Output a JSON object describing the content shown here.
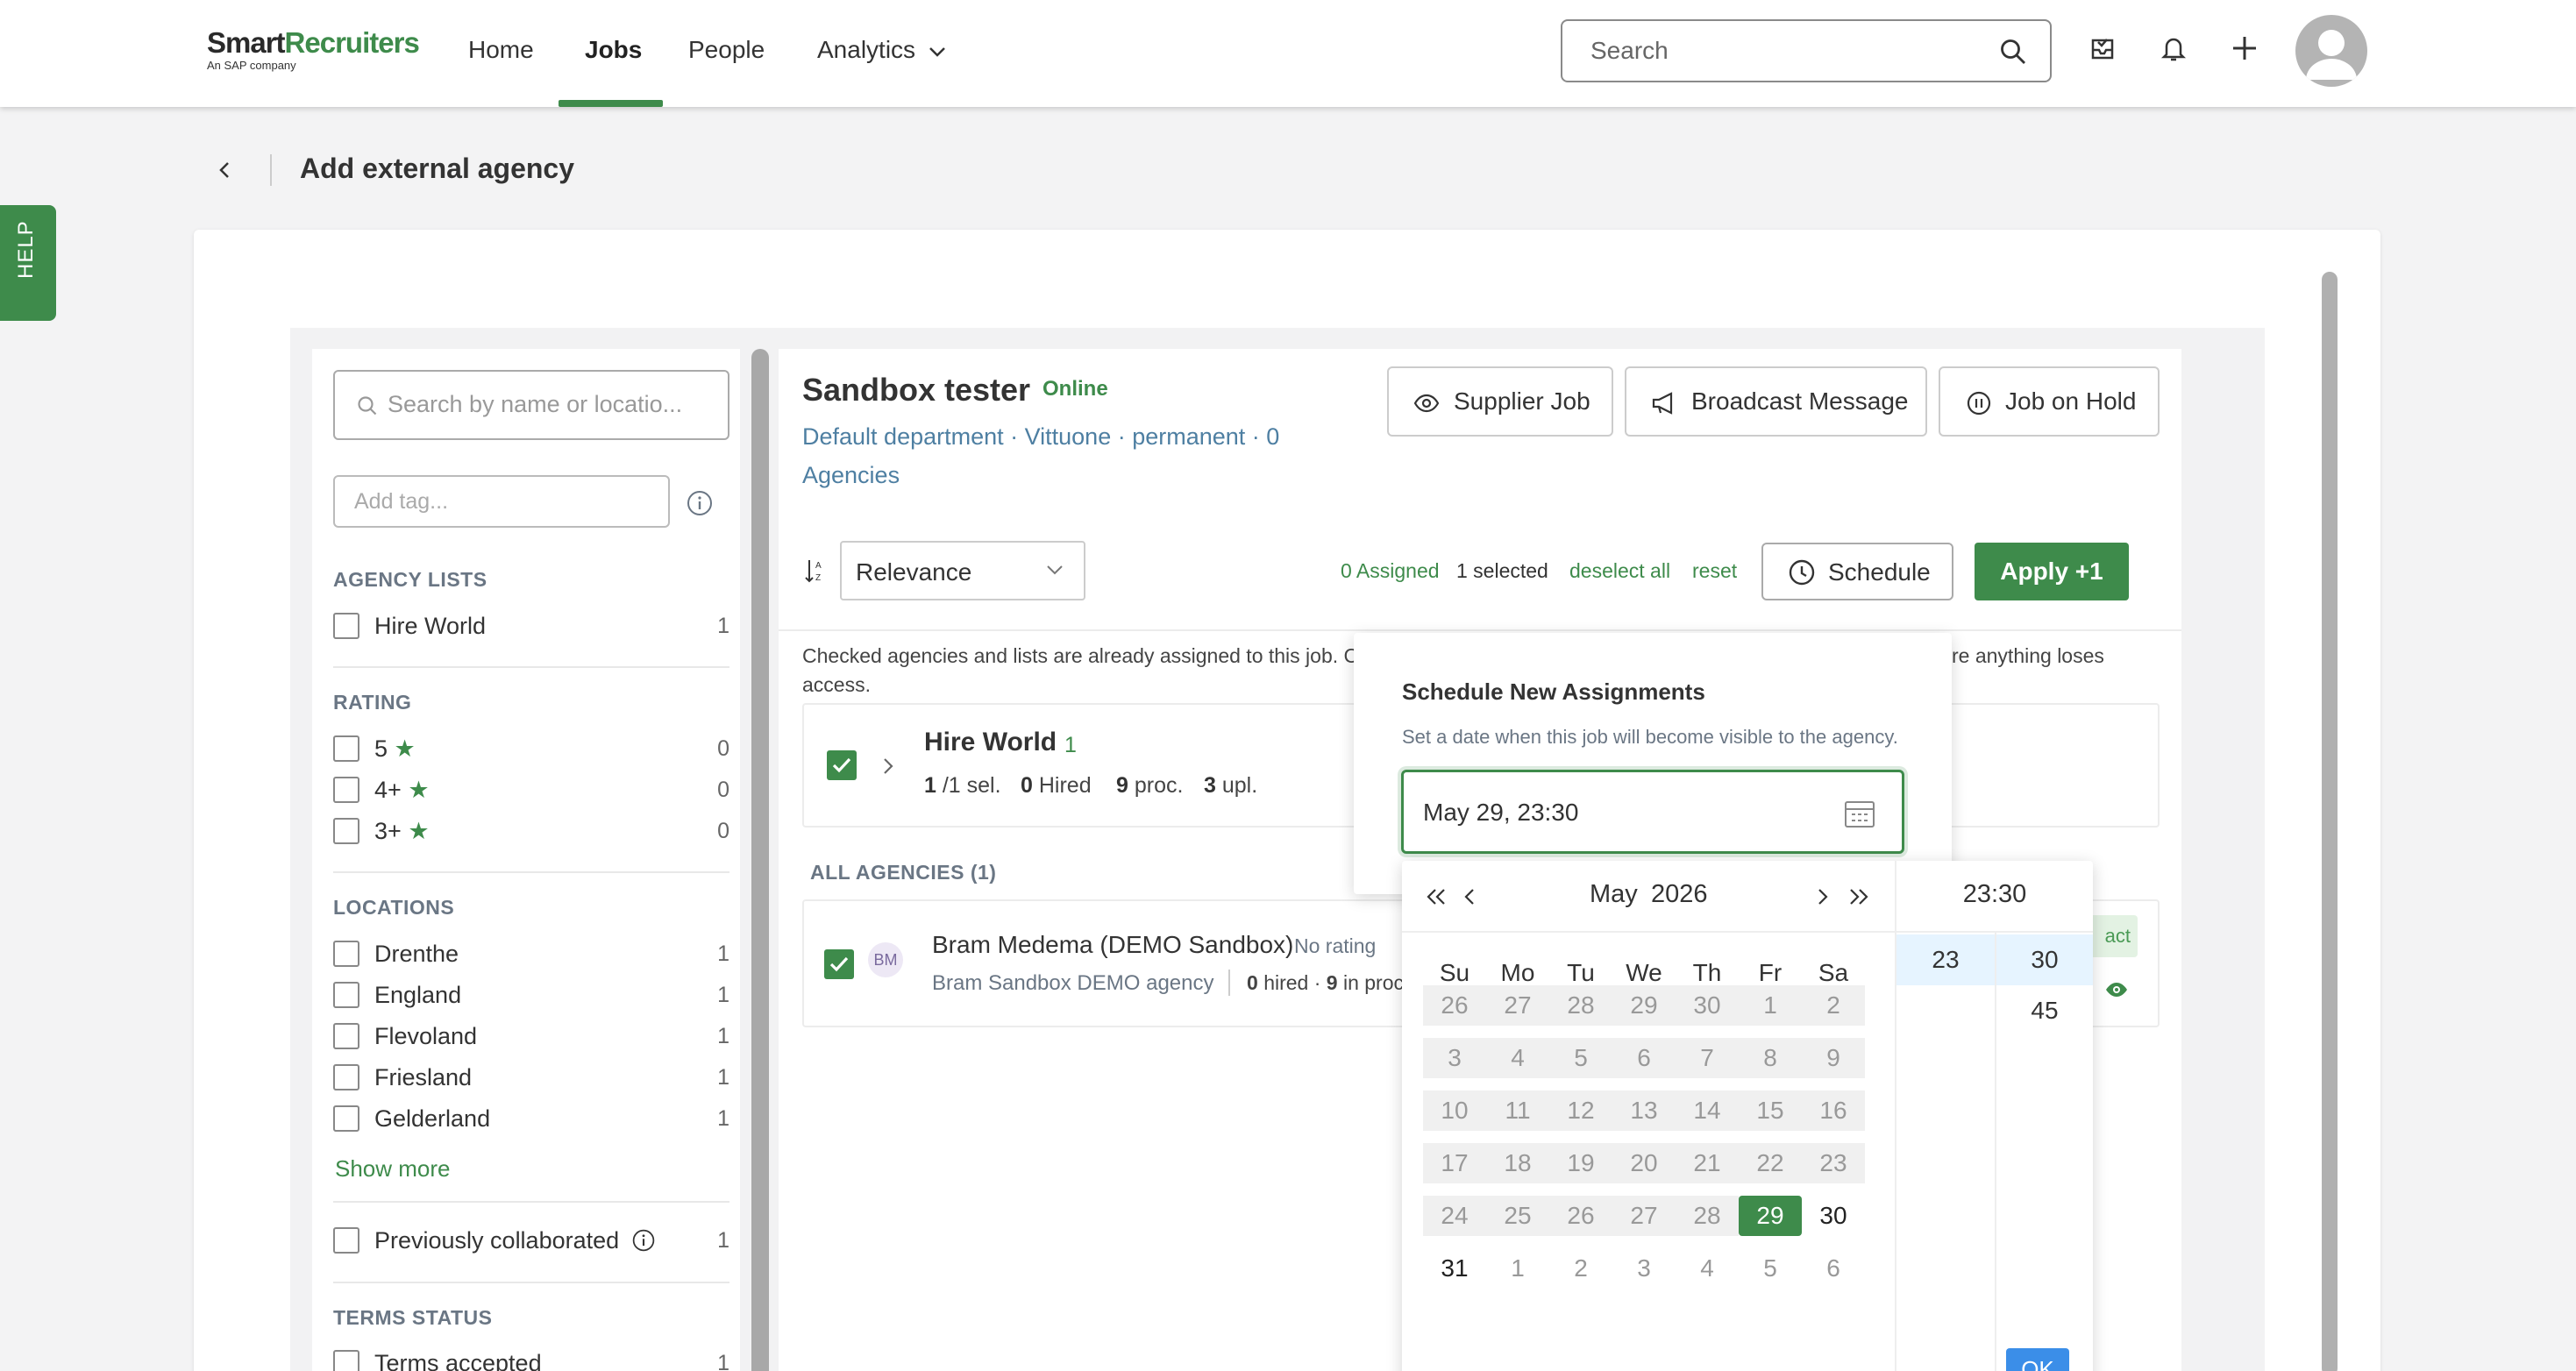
{
  "nav": {
    "logo_main_a": "Smart",
    "logo_main_b": "Recruiters",
    "logo_sub": "An SAP company",
    "links": [
      "Home",
      "Jobs",
      "People",
      "Analytics"
    ],
    "search_placeholder": "Search"
  },
  "help": "HELP",
  "page_title": "Add external agency",
  "filters": {
    "search_placeholder": "Search by name or locatio...",
    "tag_placeholder": "Add tag...",
    "agency_lists_header": "AGENCY LISTS",
    "agency_lists": [
      {
        "label": "Hire World",
        "count": "1"
      }
    ],
    "rating_header": "RATING",
    "ratings": [
      {
        "label": "5",
        "count": "0"
      },
      {
        "label": "4+",
        "count": "0"
      },
      {
        "label": "3+",
        "count": "0"
      }
    ],
    "locations_header": "LOCATIONS",
    "locations": [
      {
        "label": "Drenthe",
        "count": "1"
      },
      {
        "label": "England",
        "count": "1"
      },
      {
        "label": "Flevoland",
        "count": "1"
      },
      {
        "label": "Friesland",
        "count": "1"
      },
      {
        "label": "Gelderland",
        "count": "1"
      }
    ],
    "show_more": "Show more",
    "prev_collab": {
      "label": "Previously collaborated",
      "count": "1"
    },
    "terms_header": "TERMS STATUS",
    "terms": {
      "label": "Terms accepted",
      "count": "1"
    }
  },
  "job": {
    "title": "Sandbox tester",
    "status": "Online",
    "meta": "Default department · Vittuone · permanent · 0 Agencies",
    "buttons": {
      "supplier": "Supplier Job",
      "broadcast": "Broadcast Message",
      "hold": "Job on Hold"
    }
  },
  "toolbar": {
    "sort": "Relevance",
    "assigned": "0 Assigned",
    "selected": "1 selected",
    "deselect": "deselect all",
    "reset": "reset",
    "schedule": "Schedule",
    "apply": "Apply +1"
  },
  "note": {
    "left": "Checked agencies and lists are already assigned to this job. C",
    "right": "re anything loses",
    "line2": "access."
  },
  "hire_world": {
    "name": "Hire World",
    "count": "1",
    "sel_n": "1",
    "sel_l": "/1 sel.",
    "hired_n": "0",
    "hired_l": "Hired",
    "proc_n": "9",
    "proc_l": "proc.",
    "upl_n": "3",
    "upl_l": "upl."
  },
  "all_agencies": "ALL AGENCIES (1)",
  "agency": {
    "initials": "BM",
    "name": "Bram Medema (DEMO Sandbox)",
    "rating": "No rating",
    "sub": "Bram Sandbox DEMO agency",
    "hired_n": "0",
    "hired_l": "hired ·",
    "proc_n": "9",
    "proc_l": "in proc",
    "tag": "act"
  },
  "schedule": {
    "title": "Schedule New Assignments",
    "subtitle": "Set a date when this job will become visible to the agency.",
    "value": "May 29, 23:30"
  },
  "datepicker": {
    "month": "May",
    "year": "2026",
    "weekdays": [
      "Su",
      "Mo",
      "Tu",
      "We",
      "Th",
      "Fr",
      "Sa"
    ],
    "days": [
      [
        "26",
        "27",
        "28",
        "29",
        "30",
        "1",
        "2"
      ],
      [
        "3",
        "4",
        "5",
        "6",
        "7",
        "8",
        "9"
      ],
      [
        "10",
        "11",
        "12",
        "13",
        "14",
        "15",
        "16"
      ],
      [
        "17",
        "18",
        "19",
        "20",
        "21",
        "22",
        "23"
      ],
      [
        "24",
        "25",
        "26",
        "27",
        "28",
        "29",
        "30"
      ],
      [
        "31",
        "1",
        "2",
        "3",
        "4",
        "5",
        "6"
      ]
    ],
    "selected_day": "29",
    "time": "23:30",
    "hours": [
      "23"
    ],
    "minutes": [
      "30",
      "45"
    ],
    "ok": "OK"
  }
}
